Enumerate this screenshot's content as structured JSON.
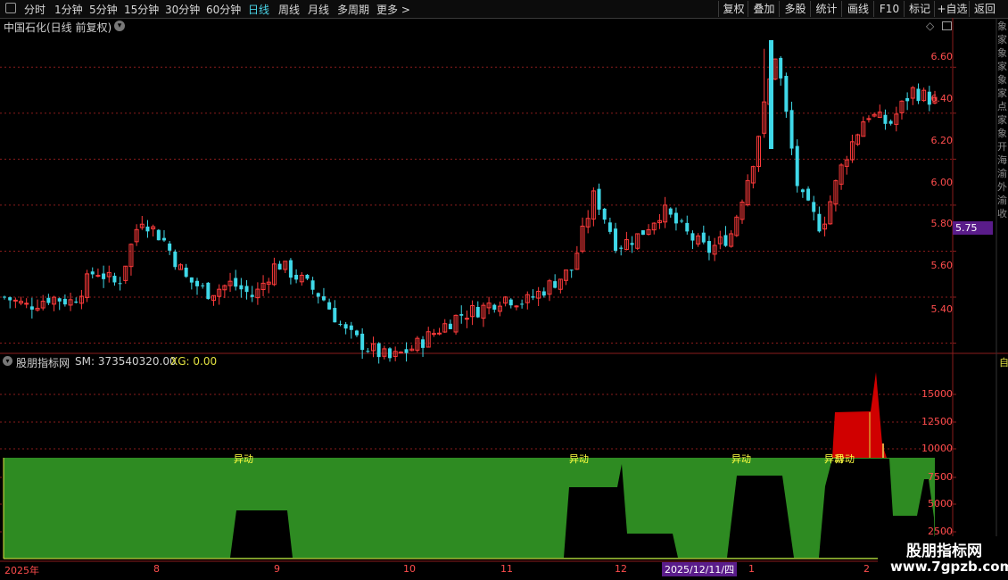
{
  "toolbar": {
    "periods": [
      "分时",
      "1分钟",
      "5分钟",
      "15分钟",
      "30分钟",
      "60分钟",
      "日线",
      "周线",
      "月线",
      "多周期",
      "更多 >"
    ],
    "active_period": "日线",
    "right_buttons": [
      "复权",
      "叠加",
      "多股",
      "统计",
      "画线",
      "F10",
      "标记",
      "+自选",
      "返回"
    ]
  },
  "stock": {
    "title": "中国石化(日线 前复权)"
  },
  "price_axis": [
    "6.60",
    "6.40",
    "6.20",
    "6.00",
    "5.80",
    "5.60",
    "5.40"
  ],
  "price_tag": "5.75",
  "indicator": {
    "name": "股朋指标网",
    "sm_label": "SM: 373540320.00",
    "xg_label": "XG: 0.00",
    "axis": [
      "15000",
      "12500",
      "10000",
      "7500",
      "5000",
      "2500"
    ],
    "signal_text": "异动"
  },
  "dates": [
    "2025年",
    "8",
    "9",
    "10",
    "11",
    "12",
    "2025/12/11/四",
    "1",
    "2"
  ],
  "side_text": "象家象家象家点家象开海渝外渝收",
  "side_top": "自",
  "watermark": {
    "cn": "股朋指标网",
    "url": "www.7gpzb.com"
  },
  "colors": {
    "up": "#ff3b3b",
    "down": "#3fd8e8",
    "grid": "#8a1c1c",
    "bg": "#000000",
    "green": "#2e8b22",
    "red": "#d00000"
  },
  "chart_data": {
    "type": "candlestick",
    "title": "中国石化(日线 前复权)",
    "ylim": [
      5.28,
      6.72
    ],
    "y_ticks": [
      5.4,
      5.6,
      5.8,
      6.0,
      6.2,
      6.4,
      6.6
    ],
    "approx_close_path": [
      5.6,
      5.56,
      5.6,
      5.58,
      5.72,
      5.65,
      5.95,
      5.85,
      5.68,
      5.62,
      5.66,
      5.6,
      5.75,
      5.68,
      5.6,
      5.45,
      5.38,
      5.33,
      5.38,
      5.45,
      5.52,
      5.55,
      5.6,
      5.58,
      5.65,
      5.72,
      6.05,
      5.82,
      5.87,
      5.98,
      5.88,
      5.8,
      5.87,
      6.2,
      6.67,
      6.05,
      5.9,
      6.2,
      6.4,
      6.35,
      6.5,
      6.45
    ]
  }
}
